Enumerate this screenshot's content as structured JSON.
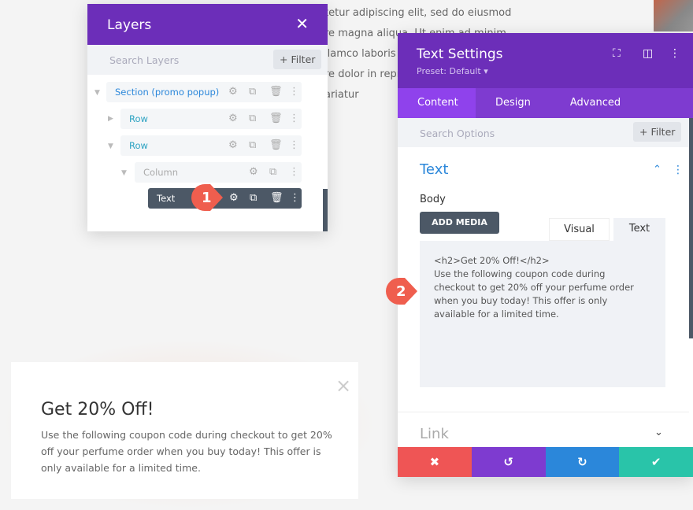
{
  "background": {
    "lines": [
      "tetur adipiscing elit, sed do eiusmod",
      "re magna aliqua. Ut enim ad minim",
      "llamco laboris",
      "re dolor in repr",
      "ariatur"
    ]
  },
  "popup": {
    "title": "Get 20% Off!",
    "body": "Use the following coupon code during checkout to get 20% off your perfume order when you buy today! This offer is only available for a limited time.",
    "close": "×"
  },
  "layers": {
    "title": "Layers",
    "close": "✕",
    "search_placeholder": "Search Layers",
    "filter": "+ Filter",
    "items": [
      {
        "label": "Section (promo popup)"
      },
      {
        "label": "Row"
      },
      {
        "label": "Row"
      },
      {
        "label": "Column"
      },
      {
        "label": "Text"
      }
    ]
  },
  "settings": {
    "title": "Text Settings",
    "preset": "Preset: Default ▾",
    "tabs": [
      "Content",
      "Design",
      "Advanced"
    ],
    "search_placeholder": "Search Options",
    "filter": "+ Filter",
    "section_title": "Text",
    "body_label": "Body",
    "add_media": "ADD MEDIA",
    "editor_tabs": [
      "Visual",
      "Text"
    ],
    "content_lines": [
      "<h2>Get 20% Off!</h2>",
      "Use the following coupon code during",
      "checkout to get 20% off your perfume order",
      "when you buy today! This offer is only",
      "available for a limited time."
    ],
    "link_section": "Link"
  },
  "markers": [
    "1",
    "2"
  ],
  "colors": {
    "purple": "#6c2eb9",
    "tab": "#7e3bd0",
    "blue": "#2b87da",
    "red": "#ef5555",
    "green": "#29c4a9"
  }
}
